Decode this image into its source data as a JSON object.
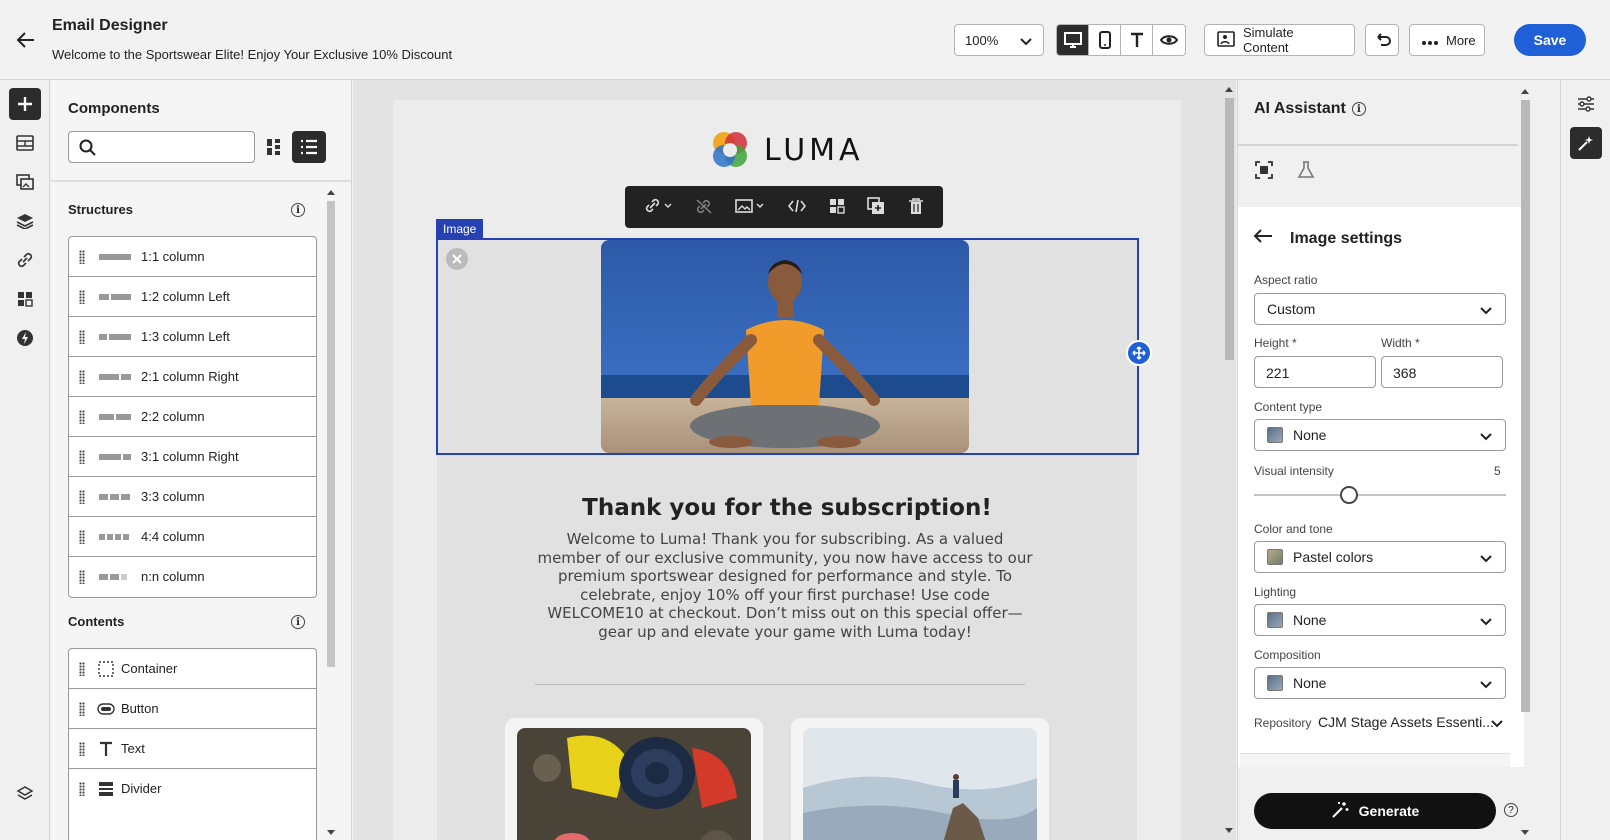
{
  "header": {
    "title": "Email Designer",
    "subtitle": "Welcome to the Sportswear Elite! Enjoy Your Exclusive 10% Discount",
    "zoom": "100%",
    "simulate_label": "Simulate Content",
    "more_label": "More",
    "save_label": "Save"
  },
  "components": {
    "title": "Components",
    "search_placeholder": "",
    "structures_title": "Structures",
    "structures": [
      {
        "label": "1:1 column"
      },
      {
        "label": "1:2 column Left"
      },
      {
        "label": "1:3 column Left"
      },
      {
        "label": "2:1 column Right"
      },
      {
        "label": "2:2 column"
      },
      {
        "label": "3:1 column Right"
      },
      {
        "label": "3:3 column"
      },
      {
        "label": "4:4 column"
      },
      {
        "label": "n:n column"
      }
    ],
    "contents_title": "Contents",
    "contents": [
      {
        "label": "Container",
        "icon": "container-icon"
      },
      {
        "label": "Button",
        "icon": "button-icon"
      },
      {
        "label": "Text",
        "icon": "text-icon"
      },
      {
        "label": "Divider",
        "icon": "divider-icon"
      }
    ]
  },
  "canvas": {
    "logo_text": "LUMA",
    "selected_tag": "Image",
    "heading": "Thank you for the subscription!",
    "body": "Welcome to Luma! Thank you for subscribing. As a valued member of our exclusive community, you now have access to our premium sportswear designed for performance and style. To celebrate, enjoy 10% off your first purchase! Use code WELCOME10 at checkout. Don’t miss out on this special offer—gear up and elevate your game with Luma today!"
  },
  "ai_assistant": {
    "title": "AI Assistant",
    "panel_title": "Image settings",
    "aspect_ratio_label": "Aspect ratio",
    "aspect_ratio_value": "Custom",
    "height_label": "Height *",
    "height_value": "221",
    "width_label": "Width *",
    "width_value": "368",
    "content_type_label": "Content type",
    "content_type_value": "None",
    "visual_intensity_label": "Visual intensity",
    "visual_intensity_value": "5",
    "color_tone_label": "Color and tone",
    "color_tone_value": "Pastel colors",
    "lighting_label": "Lighting",
    "lighting_value": "None",
    "composition_label": "Composition",
    "composition_value": "None",
    "repository_label": "Repository",
    "repository_value": "CJM Stage Assets Essenti...",
    "generate_label": "Generate"
  },
  "colors": {
    "accent": "#1f5fd7",
    "selection": "#2541b2",
    "dark": "#2c2c2c"
  }
}
